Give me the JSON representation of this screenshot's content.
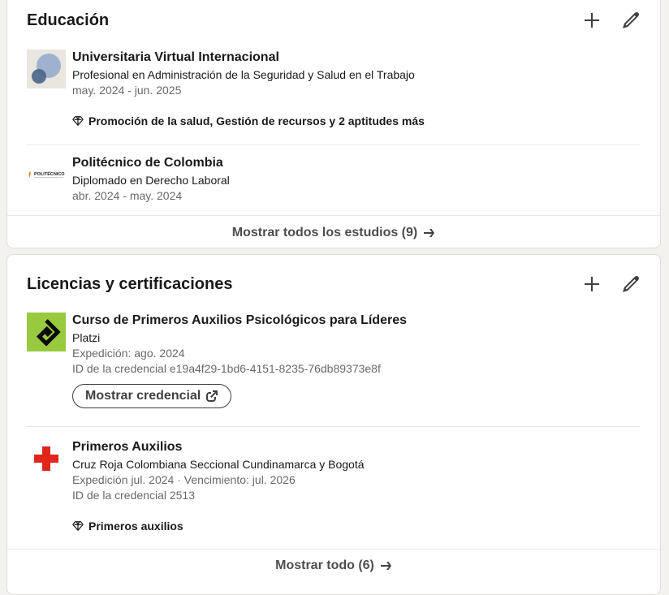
{
  "education": {
    "title": "Educación",
    "add_icon": "plus-icon",
    "edit_icon": "pencil-icon",
    "items": [
      {
        "school": "Universitaria Virtual Internacional",
        "degree": "Profesional en Administración de la Seguridad y Salud en el Trabajo",
        "dates": "may. 2024 - jun. 2025",
        "skills": "Promoción de la salud, Gestión de recursos y 2 aptitudes más"
      },
      {
        "school": "Politécnico de Colombia",
        "degree": "Diplomado en Derecho Laboral",
        "dates": "abr. 2024 - may. 2024",
        "logo_text": "POLITÉCNICO"
      }
    ],
    "show_all": "Mostrar todos los estudios (9)"
  },
  "licenses": {
    "title": "Licencias y certificaciones",
    "add_icon": "plus-icon",
    "edit_icon": "pencil-icon",
    "items": [
      {
        "name": "Curso de Primeros Auxilios Psicológicos para Líderes",
        "issuer": "Platzi",
        "issued": "Expedición: ago. 2024",
        "credential_id": "ID de la credencial e19a4f29-1bd6-4151-8235-76db89373e8f",
        "button": "Mostrar credencial"
      },
      {
        "name": "Primeros Auxilios",
        "issuer": "Cruz Roja Colombiana Seccional Cundinamarca y Bogotá",
        "issued": "Expedición jul. 2024 · Vencimiento: jul. 2026",
        "credential_id": "ID de la credencial 2513",
        "skills": "Primeros auxilios"
      }
    ],
    "show_all": "Mostrar todo (6)"
  },
  "colors": {
    "platzi_green": "#98ca3f",
    "red_cross": "#e1251b",
    "uvi_blue": "#8fa9cc",
    "uvi_dark": "#4a6488"
  }
}
